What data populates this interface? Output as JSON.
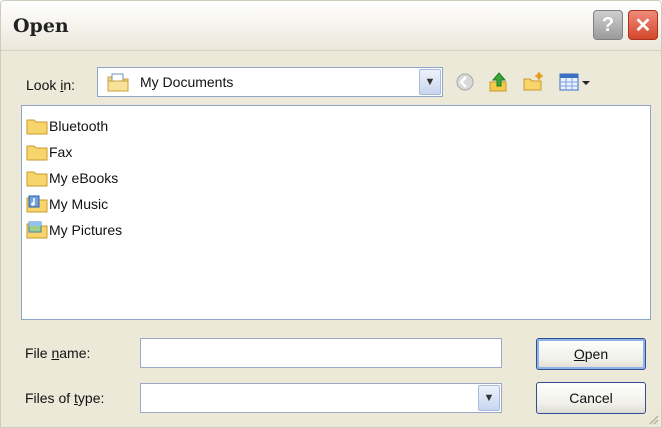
{
  "window": {
    "title": "Open"
  },
  "title_buttons": {
    "help": "?",
    "close": "✕"
  },
  "lookin": {
    "label_pre": "Look ",
    "label_mn": "i",
    "label_post": "n:",
    "value": "My Documents"
  },
  "toolbar_icons": [
    "back-icon",
    "up-folder-icon",
    "new-folder-icon",
    "views-menu-icon"
  ],
  "files": [
    {
      "name": "Bluetooth",
      "icon": "folder-icon"
    },
    {
      "name": "Fax",
      "icon": "folder-icon"
    },
    {
      "name": "My eBooks",
      "icon": "folder-icon"
    },
    {
      "name": "My Music",
      "icon": "music-folder-icon"
    },
    {
      "name": "My Pictures",
      "icon": "pictures-folder-icon"
    }
  ],
  "filename": {
    "label_pre": "File ",
    "label_mn": "n",
    "label_post": "ame:",
    "value": ""
  },
  "filetype": {
    "label_pre": "Files of ",
    "label_mn": "t",
    "label_post": "ype:",
    "value": ""
  },
  "buttons": {
    "open_mn": "O",
    "open_rest": "pen",
    "cancel": "Cancel"
  },
  "colors": {
    "dialog_bg": "#ece9d8",
    "close_red": "#d4472c",
    "field_border": "#8fa6c8"
  }
}
